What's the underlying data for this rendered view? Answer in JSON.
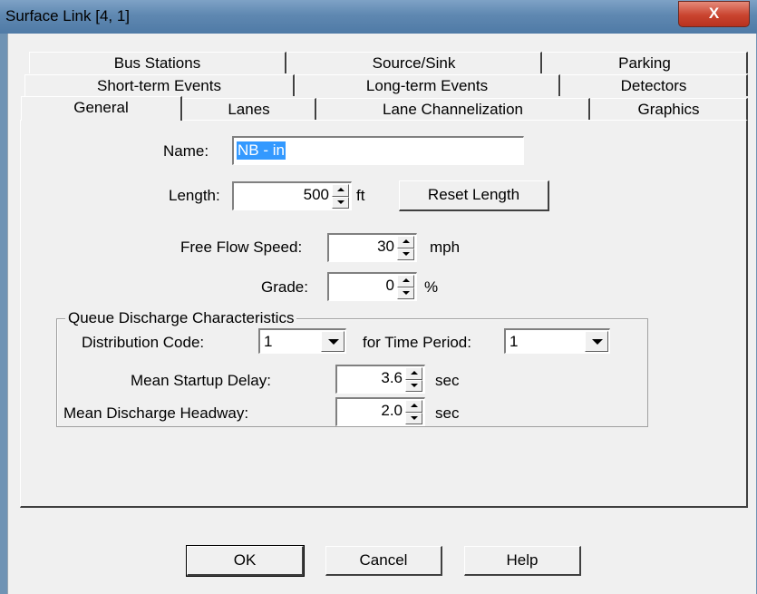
{
  "window": {
    "title": "Surface Link [4, 1]",
    "close_glyph": "X"
  },
  "tabs": {
    "row1": [
      "Bus Stations",
      "Source/Sink",
      "Parking"
    ],
    "row2": [
      "Short-term Events",
      "Long-term Events",
      "Detectors"
    ],
    "row3": [
      "General",
      "Lanes",
      "Lane Channelization",
      "Graphics"
    ],
    "selected": "General"
  },
  "general": {
    "name_label": "Name:",
    "name_value": "NB - in",
    "length_label": "Length:",
    "length_value": "500",
    "length_unit": "ft",
    "reset_length_button": "Reset Length",
    "free_flow_label": "Free Flow Speed:",
    "free_flow_value": "30",
    "free_flow_unit": "mph",
    "grade_label": "Grade:",
    "grade_value": "0",
    "grade_unit": "%"
  },
  "queue": {
    "group_title": "Queue Discharge Characteristics",
    "distribution_label": "Distribution Code:",
    "distribution_value": "1",
    "time_period_label": "for Time Period:",
    "time_period_value": "1",
    "startup_label": "Mean Startup Delay:",
    "startup_value": "3.6",
    "startup_unit": "sec",
    "headway_label": "Mean Discharge Headway:",
    "headway_value": "2.0",
    "headway_unit": "sec"
  },
  "buttons": {
    "ok": "OK",
    "cancel": "Cancel",
    "help": "Help"
  }
}
